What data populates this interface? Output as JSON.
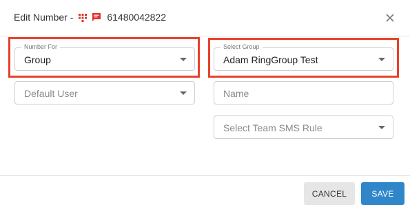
{
  "dialog": {
    "title": "Edit Number -",
    "phone_number": "61480042822",
    "icons": [
      "dialpad-icon",
      "message-icon",
      "close-icon"
    ]
  },
  "form": {
    "number_for": {
      "label": "Number For",
      "value": "Group"
    },
    "select_group": {
      "label": "Select Group",
      "value": "Adam RingGroup Test"
    },
    "default_user": {
      "placeholder": "Default User"
    },
    "name": {
      "placeholder": "Name"
    },
    "team_sms_rule": {
      "placeholder": "Select Team SMS Rule"
    }
  },
  "footer": {
    "cancel_label": "CANCEL",
    "save_label": "SAVE"
  },
  "colors": {
    "highlight": "#e8402a",
    "primary": "#2f86c8",
    "icon_red": "#e0342a"
  }
}
